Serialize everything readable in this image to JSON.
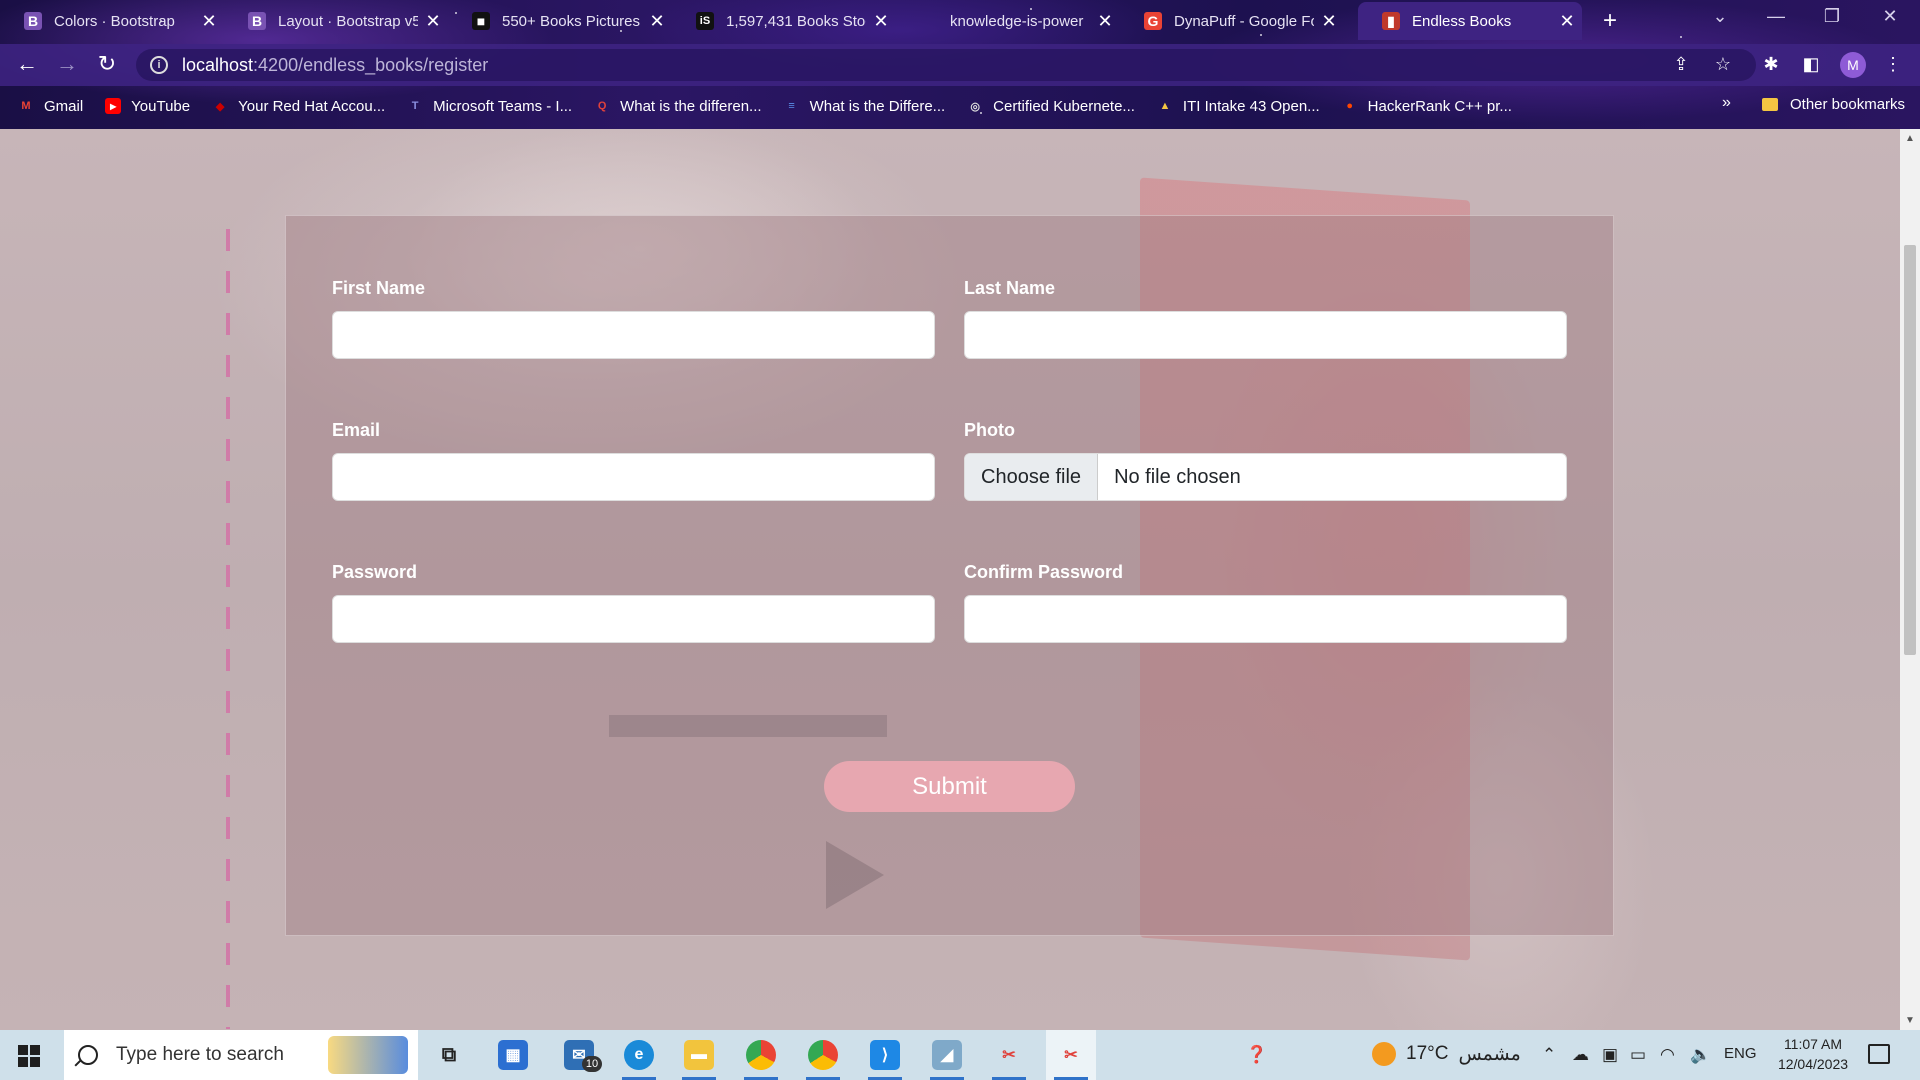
{
  "browser": {
    "tabs": [
      {
        "title": "Colors · Bootstrap",
        "icon": "bootstrap-icon",
        "color": "#7952b3",
        "letter": "B"
      },
      {
        "title": "Layout · Bootstrap v5",
        "icon": "bootstrap-icon",
        "color": "#7952b3",
        "letter": "B"
      },
      {
        "title": "550+ Books Pictures",
        "icon": "unsplash-icon",
        "color": "#111111",
        "letter": "■"
      },
      {
        "title": "1,597,431 Books Stock",
        "icon": "istock-icon",
        "color": "#111111",
        "letter": "iS"
      },
      {
        "title": "knowledge-is-power",
        "icon": "blank-icon",
        "color": "",
        "letter": ""
      },
      {
        "title": "DynaPuff - Google Fo",
        "icon": "google-fonts-icon",
        "color": "#ea4335",
        "letter": "G"
      },
      {
        "title": "Endless Books",
        "icon": "book-icon",
        "color": "#c0392b",
        "letter": "▮",
        "active": true
      }
    ],
    "url_host": "localhost",
    "url_path": ":4200/endless_books/register",
    "profile_initial": "M",
    "bookmarks": [
      {
        "label": "Gmail",
        "icon": "gmail-icon",
        "color": "#ea4335",
        "letter": "M"
      },
      {
        "label": "YouTube",
        "icon": "youtube-icon",
        "color": "#ff0000",
        "letter": "▶"
      },
      {
        "label": "Your Red Hat Accou...",
        "icon": "redhat-icon",
        "color": "#cc0000",
        "letter": "◆"
      },
      {
        "label": "Microsoft Teams - I...",
        "icon": "teams-icon",
        "color": "#5b5fc7",
        "letter": "T"
      },
      {
        "label": "What is the differen...",
        "icon": "quora-icon",
        "color": "#b92b27",
        "letter": "Q"
      },
      {
        "label": "What is the Differe...",
        "icon": "list-icon",
        "color": "#3b6fd8",
        "letter": "≡"
      },
      {
        "label": "Certified Kubernete...",
        "icon": "kubernetes-icon",
        "color": "#6b6b9b",
        "letter": "◎"
      },
      {
        "label": "ITI Intake 43 Open...",
        "icon": "google-drive-icon",
        "color": "#1fa463",
        "letter": "▲"
      },
      {
        "label": "HackerRank C++ pr...",
        "icon": "reddit-icon",
        "color": "#ff4500",
        "letter": "●"
      }
    ],
    "bookmarks_more": "»",
    "other_bookmarks": "Other bookmarks"
  },
  "form": {
    "first_name_label": "First Name",
    "last_name_label": "Last Name",
    "email_label": "Email",
    "photo_label": "Photo",
    "choose_file": "Choose file",
    "no_file": "No file chosen",
    "password_label": "Password",
    "confirm_password_label": "Confirm Password",
    "submit": "Submit"
  },
  "taskbar": {
    "search_placeholder": "Type here to search",
    "mail_badge": "10",
    "temperature": "17°C",
    "weather_text": "مشمس",
    "language": "ENG",
    "time": "11:07 AM",
    "date": "12/04/2023"
  }
}
